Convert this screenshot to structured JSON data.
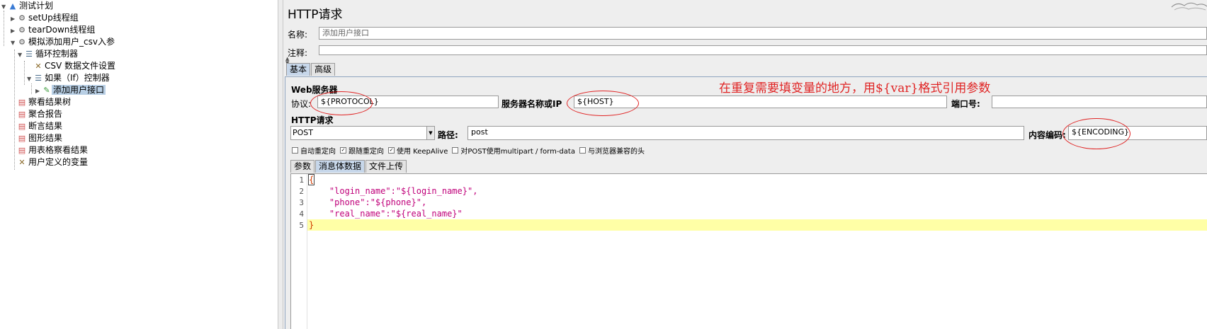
{
  "tree": {
    "items": [
      {
        "label": "测试计划",
        "icon": "triangle-icon"
      },
      {
        "label": "setUp线程组",
        "icon": "gear-icon"
      },
      {
        "label": "tearDown线程组",
        "icon": "gear-icon"
      },
      {
        "label": "模拟添加用户_csv入参",
        "icon": "gear-icon"
      },
      {
        "label": "循环控制器",
        "icon": "controller-icon"
      },
      {
        "label": "CSV 数据文件设置",
        "icon": "config-x-icon"
      },
      {
        "label": "如果（If）控制器",
        "icon": "controller-icon"
      },
      {
        "label": "添加用户接口",
        "icon": "sampler-icon"
      },
      {
        "label": "察看结果树",
        "icon": "report-icon"
      },
      {
        "label": "聚合报告",
        "icon": "report-icon"
      },
      {
        "label": "断言结果",
        "icon": "report-icon"
      },
      {
        "label": "图形结果",
        "icon": "report-icon"
      },
      {
        "label": "用表格察看结果",
        "icon": "report-icon"
      },
      {
        "label": "用户定义的变量",
        "icon": "config-x-icon"
      }
    ]
  },
  "panel": {
    "title": "HTTP请求",
    "name_label": "名称:",
    "name_value": "添加用户接口",
    "comment_label": "注释:",
    "comment_value": "",
    "tabs": [
      "基本",
      "高级"
    ],
    "web_server_title": "Web服务器",
    "protocol_label": "协议:",
    "protocol_value": "${PROTOCOL}",
    "server_label": "服务器名称或IP",
    "server_value": "${HOST}",
    "port_label": "端口号:",
    "port_value": "",
    "http_request_title": "HTTP请求",
    "method_value": "POST",
    "path_label": "路径:",
    "path_value": "post",
    "encoding_label": "内容编码:",
    "encoding_value": "${ENCODING}",
    "annotation": "在重复需要填变量的地方，用${var}格式引用参数",
    "checkboxes": [
      {
        "label": "自动重定向",
        "checked": false
      },
      {
        "label": "跟随重定向",
        "checked": true
      },
      {
        "label": "使用 KeepAlive",
        "checked": true
      },
      {
        "label": "对POST使用multipart / form-data",
        "checked": false
      },
      {
        "label": "与浏览器兼容的头",
        "checked": false
      }
    ],
    "body_tabs": [
      "参数",
      "消息体数据",
      "文件上传"
    ],
    "code_lines": [
      {
        "num": "1",
        "text": "{"
      },
      {
        "num": "2",
        "text": "    \"login_name\":\"${login_name}\","
      },
      {
        "num": "3",
        "text": "    \"phone\":\"${phone}\","
      },
      {
        "num": "4",
        "text": "    \"real_name\":\"${real_name}\""
      },
      {
        "num": "5",
        "text": "}"
      }
    ]
  },
  "colors": {
    "annotation": "#e02424",
    "selected_tab": "#c7d7ea",
    "code_text": "#c0007a",
    "highlight_line": "#ffffa6"
  }
}
